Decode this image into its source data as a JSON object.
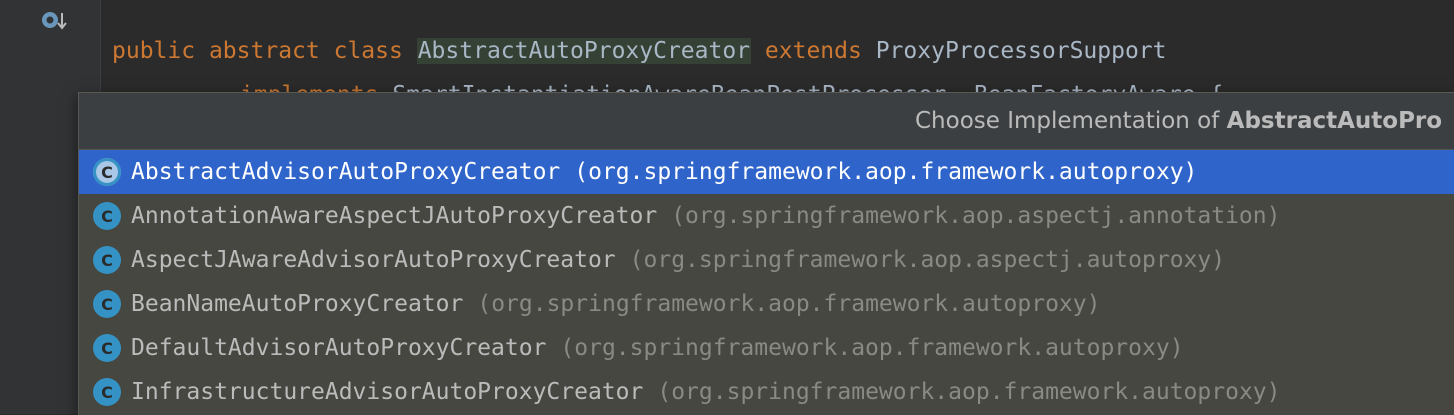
{
  "editor": {
    "line1": {
      "kw_public": "public",
      "kw_abstract": "abstract",
      "kw_class": "class",
      "class_name": "AbstractAutoProxyCreator",
      "kw_extends": "extends",
      "super_class": "ProxyProcessorSupport"
    },
    "line2": {
      "kw_implements": "implements",
      "iface1": "SmartInstantiationAwareBeanPostProcessor",
      "comma": ",",
      "iface2": "BeanFactoryAware",
      "brace": "{"
    }
  },
  "popup": {
    "title_prefix": "Choose Implementation of ",
    "title_bold": "AbstractAutoPro",
    "items": [
      {
        "icon": "C",
        "name": "AbstractAdvisorAutoProxyCreator",
        "package": "(org.springframework.aop.framework.autoproxy)",
        "selected": true,
        "abstract": true
      },
      {
        "icon": "C",
        "name": "AnnotationAwareAspectJAutoProxyCreator",
        "package": "(org.springframework.aop.aspectj.annotation)",
        "selected": false
      },
      {
        "icon": "C",
        "name": "AspectJAwareAdvisorAutoProxyCreator",
        "package": "(org.springframework.aop.aspectj.autoproxy)",
        "selected": false
      },
      {
        "icon": "C",
        "name": "BeanNameAutoProxyCreator",
        "package": "(org.springframework.aop.framework.autoproxy)",
        "selected": false
      },
      {
        "icon": "C",
        "name": "DefaultAdvisorAutoProxyCreator",
        "package": "(org.springframework.aop.framework.autoproxy)",
        "selected": false
      },
      {
        "icon": "C",
        "name": "InfrastructureAdvisorAutoProxyCreator",
        "package": "(org.springframework.aop.framework.autoproxy)",
        "selected": false
      }
    ]
  },
  "colors": {
    "selection": "#2f65ca",
    "keyword": "#cc7832",
    "class_icon": "#3592c4"
  }
}
